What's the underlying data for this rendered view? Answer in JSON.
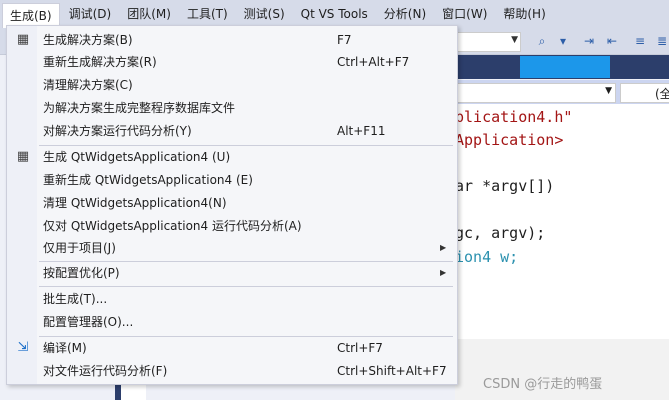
{
  "menubar": {
    "items": [
      {
        "label": "生成(B)"
      },
      {
        "label": "调试(D)"
      },
      {
        "label": "团队(M)"
      },
      {
        "label": "工具(T)"
      },
      {
        "label": "测试(S)"
      },
      {
        "label": "Qt VS Tools"
      },
      {
        "label": "分析(N)"
      },
      {
        "label": "窗口(W)"
      },
      {
        "label": "帮助(H)"
      }
    ]
  },
  "nav": {
    "member_combo": "(全"
  },
  "editor": {
    "lines": [
      "plication4.h\"",
      "Application>",
      "ar *argv[])",
      "gc, argv);",
      "ion4 w;"
    ]
  },
  "build_menu": {
    "items": [
      {
        "label": "生成解决方案(B)",
        "shortcut": "F7",
        "icon": "build-solution-icon"
      },
      {
        "label": "重新生成解决方案(R)",
        "shortcut": "Ctrl+Alt+F7"
      },
      {
        "label": "清理解决方案(C)",
        "shortcut": ""
      },
      {
        "label": "为解决方案生成完整程序数据库文件",
        "shortcut": ""
      },
      {
        "label": "对解决方案运行代码分析(Y)",
        "shortcut": "Alt+F11"
      },
      {
        "label": "生成 QtWidgetsApplication4 (U)",
        "shortcut": "",
        "icon": "build-project-icon"
      },
      {
        "label": "重新生成 QtWidgetsApplication4 (E)",
        "shortcut": ""
      },
      {
        "label": "清理 QtWidgetsApplication4(N)",
        "shortcut": ""
      },
      {
        "label": "仅对 QtWidgetsApplication4 运行代码分析(A)",
        "shortcut": ""
      },
      {
        "label": "仅用于项目(J)",
        "shortcut": "",
        "submenu": true
      },
      {
        "label": "按配置优化(P)",
        "shortcut": "",
        "submenu": true
      },
      {
        "label": "批生成(T)...",
        "shortcut": ""
      },
      {
        "label": "配置管理器(O)...",
        "shortcut": ""
      },
      {
        "label": "编译(M)",
        "shortcut": "Ctrl+F7",
        "icon": "compile-icon"
      },
      {
        "label": "对文件运行代码分析(F)",
        "shortcut": "Ctrl+Shift+Alt+F7"
      }
    ]
  },
  "watermark": "CSDN @行走的鸭蛋"
}
